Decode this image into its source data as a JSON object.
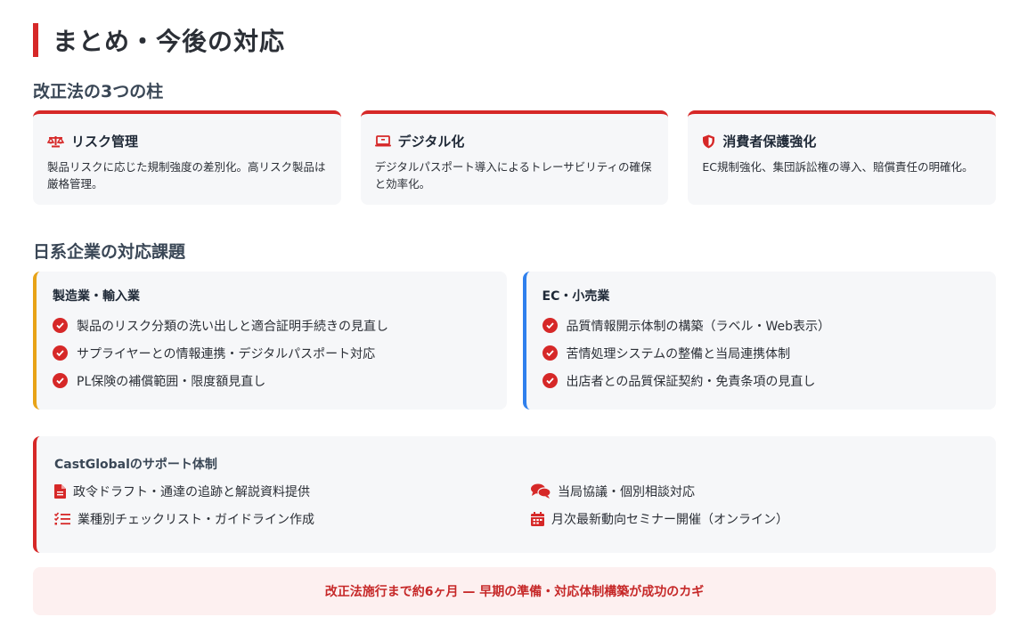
{
  "title": "まとめ・今後の対応",
  "pillars_heading": "改正法の3つの柱",
  "pillars": [
    {
      "icon": "balance-scale-icon",
      "title": "リスク管理",
      "desc": "製品リスクに応じた規制強度の差別化。高リスク製品は厳格管理。"
    },
    {
      "icon": "laptop-icon",
      "title": "デジタル化",
      "desc": "デジタルパスポート導入によるトレーサビリティの確保と効率化。"
    },
    {
      "icon": "shield-icon",
      "title": "消費者保護強化",
      "desc": "EC規制強化、集団訴訟権の導入、賠償責任の明確化。"
    }
  ],
  "issues_heading": "日系企業の対応課題",
  "issues": {
    "manufacturing": {
      "title": "製造業・輸入業",
      "items": [
        "製品のリスク分類の洗い出しと適合証明手続きの見直し",
        "サプライヤーとの情報連携・デジタルパスポート対応",
        "PL保険の補償範囲・限度額見直し"
      ]
    },
    "ec": {
      "title": "EC・小売業",
      "items": [
        "品質情報開示体制の構築（ラベル・Web表示）",
        "苦情処理システムの整備と当局連携体制",
        "出店者との品質保証契約・免責条項の見直し"
      ]
    }
  },
  "support": {
    "title": "CastGlobalのサポート体制",
    "items": [
      {
        "icon": "document-icon",
        "label": "政令ドラフト・通達の追跡と解説資料提供"
      },
      {
        "icon": "chat-icon",
        "label": "当局協議・個別相談対応"
      },
      {
        "icon": "checklist-icon",
        "label": "業種別チェックリスト・ガイドライン作成"
      },
      {
        "icon": "calendar-icon",
        "label": "月次最新動向セミナー開催（オンライン）"
      }
    ]
  },
  "banner": "改正法施行まで約6ヶ月 — 早期の準備・対応体制構築が成功のカギ",
  "colors": {
    "accent": "#d62828",
    "manufacturing_border": "#e8a317",
    "ec_border": "#2f80ed",
    "banner_bg": "#fdf0f0",
    "card_bg": "#f6f7f9"
  }
}
